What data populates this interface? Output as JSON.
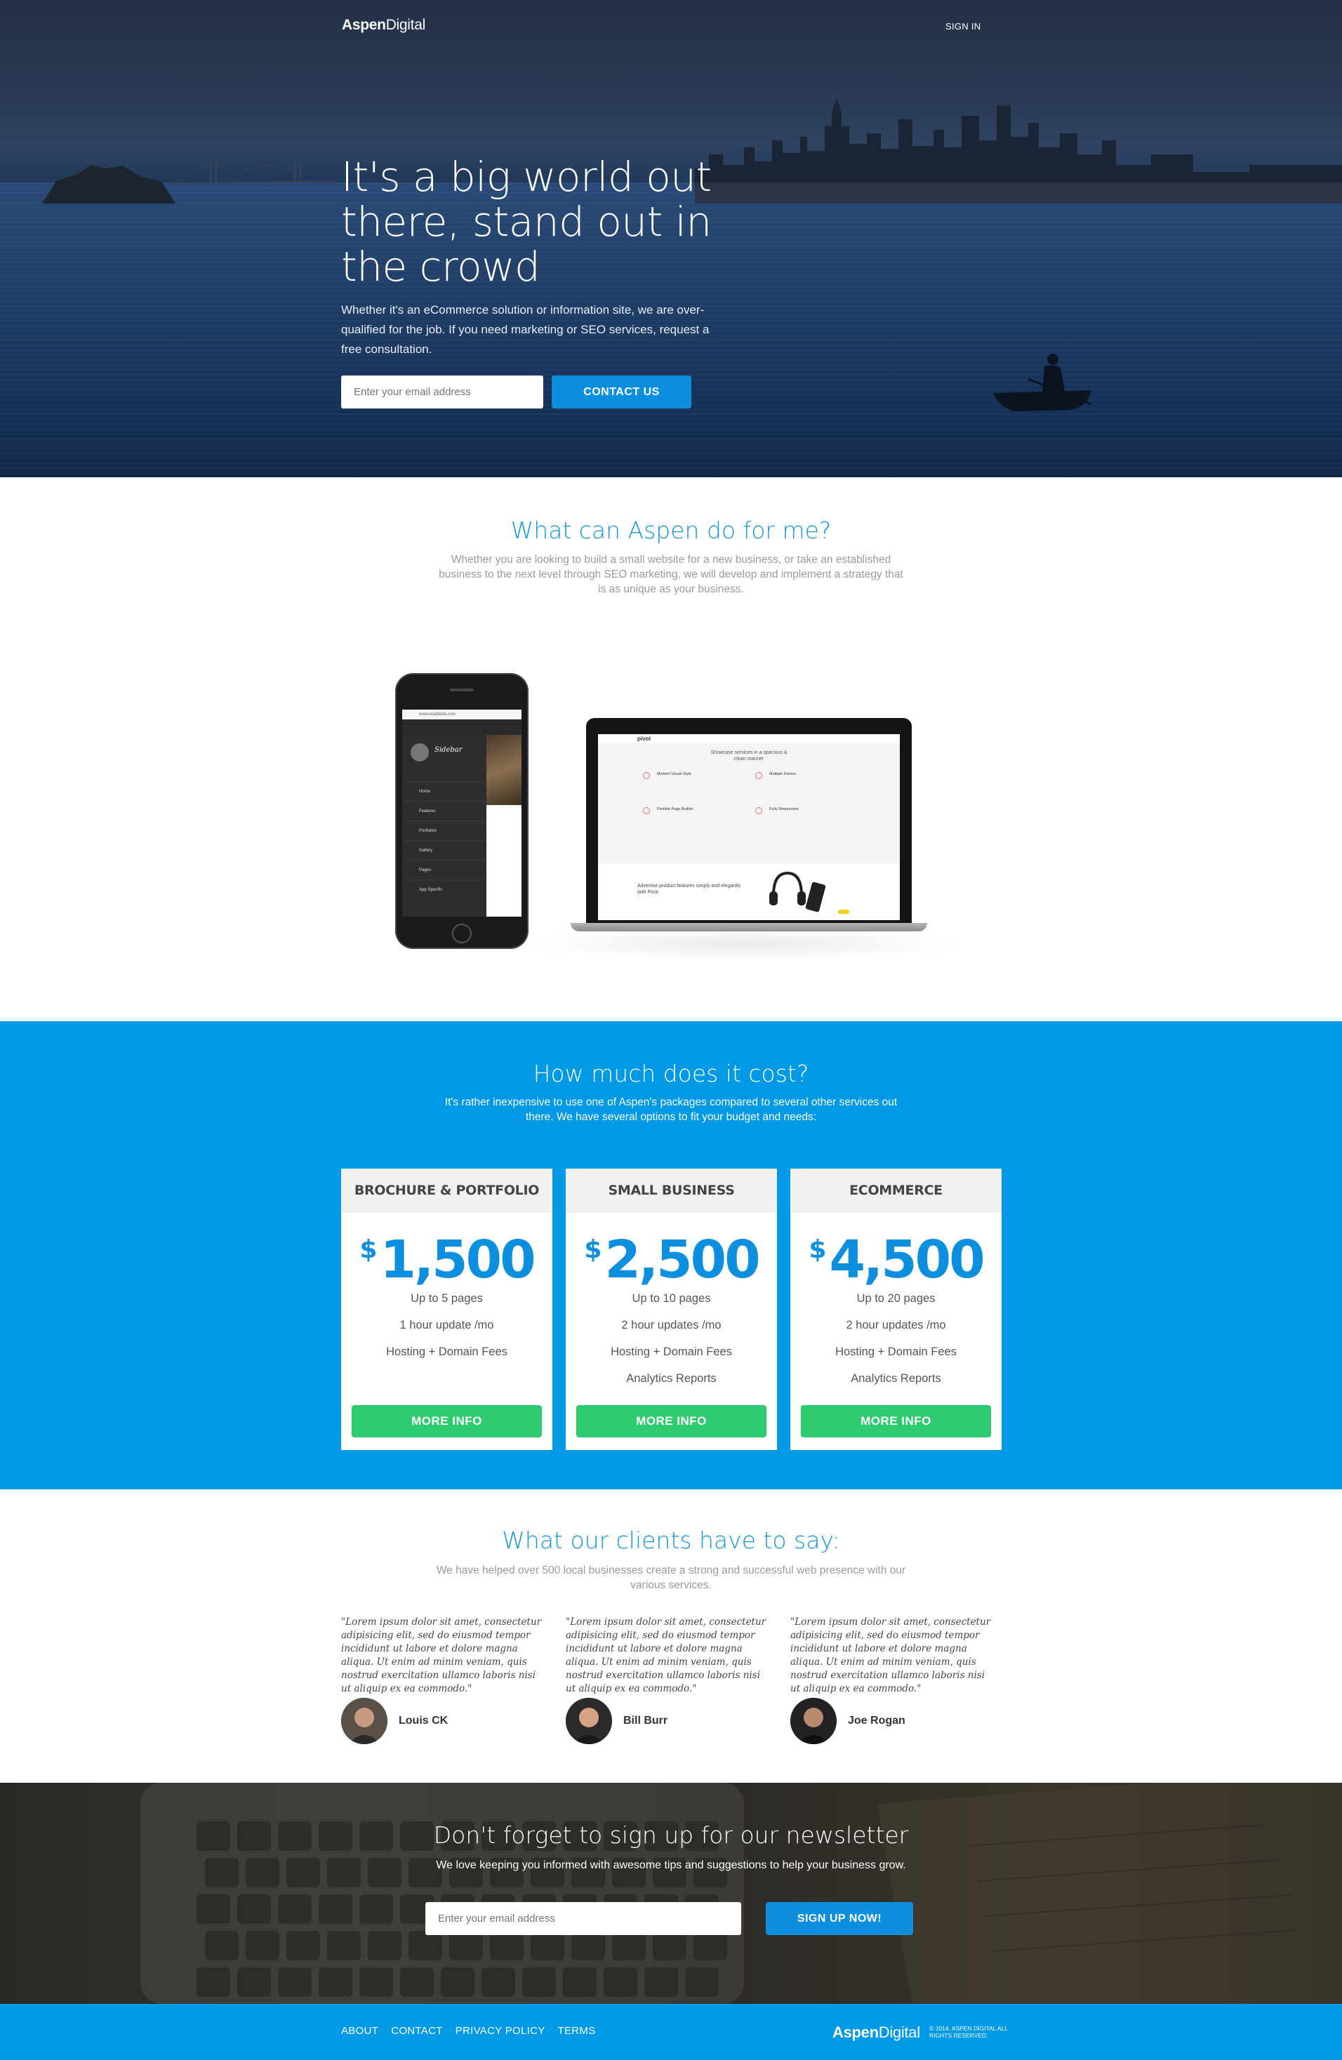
{
  "header": {
    "brand_bold": "Aspen",
    "brand_light": "Digital",
    "signin_label": "SIGN IN"
  },
  "hero": {
    "title": "It's a big world out there, stand out in the crowd",
    "lead": "Whether it's an eCommerce solution or information site, we are over-qualified for the job. If you need marketing or SEO services, request a free consultation.",
    "email_placeholder": "Enter your email address",
    "contact_label": "CONTACT US"
  },
  "services": {
    "title": "What can Aspen do for me?",
    "subtitle": "Whether you are looking to build a small website for a new business, or take an established business to the next level through SEO marketing, we will develop and implement a strategy that is as unique as your business."
  },
  "pricing": {
    "title": "How much does it cost?",
    "subtitle": "It's rather inexpensive to use one of Aspen's packages compared to several other services out there. We have several options to fit your budget and needs:",
    "plans": [
      {
        "name": "BROCHURE & PORTFOLIO",
        "currency": "$",
        "price": "1,500",
        "features": [
          "Up to 5 pages",
          "1 hour update /mo",
          "Hosting + Domain Fees"
        ],
        "button": "MORE INFO"
      },
      {
        "name": "SMALL BUSINESS",
        "currency": "$",
        "price": "2,500",
        "features": [
          "Up to 10 pages",
          "2 hour updates /mo",
          "Hosting + Domain Fees",
          "Analytics Reports"
        ],
        "button": "MORE INFO"
      },
      {
        "name": "ECOMMERCE",
        "currency": "$",
        "price": "4,500",
        "features": [
          "Up to 20 pages",
          "2 hour updates /mo",
          "Hosting + Domain Fees",
          "Analytics Reports"
        ],
        "button": "MORE INFO"
      }
    ]
  },
  "testimonials": {
    "title": "What our clients have to say:",
    "subtitle": "We have helped over 500 local businesses create a strong and successful web presence with our various services.",
    "items": [
      {
        "quote": "\"Lorem ipsum dolor sit amet, consectetur adipisicing elit, sed do eiusmod tempor incididunt ut labore et dolore magna aliqua. Ut enim ad minim veniam, quis nostrud exercitation ullamco laboris nisi ut aliquip ex ea commodo.\"",
        "name": "Louis CK"
      },
      {
        "quote": "\"Lorem ipsum dolor sit amet, consectetur adipisicing elit, sed do eiusmod tempor incididunt ut labore et dolore magna aliqua. Ut enim ad minim veniam, quis nostrud exercitation ullamco laboris nisi ut aliquip ex ea commodo.\"",
        "name": "Bill Burr"
      },
      {
        "quote": "\"Lorem ipsum dolor sit amet, consectetur adipisicing elit, sed do eiusmod tempor incididunt ut labore et dolore magna aliqua. Ut enim ad minim veniam, quis nostrud exercitation ullamco laboris nisi ut aliquip ex ea commodo.\"",
        "name": "Joe Rogan"
      }
    ]
  },
  "newsletter": {
    "title": "Don't forget to sign up for our newsletter",
    "subtitle": "We love keeping you informed with awesome tips and suggestions to help your business grow.",
    "email_placeholder": "Enter your email address",
    "button": "SIGN UP NOW!"
  },
  "footer": {
    "links": [
      "ABOUT",
      "CONTACT",
      "PRIVACY POLICY",
      "TERMS"
    ],
    "brand_bold": "Aspen",
    "brand_light": "Digital",
    "copyright": "© 2014. ASPEN DIGITAL ALL RIGHTS RESERVED."
  },
  "devices": {
    "laptop_brand": "pivot",
    "laptop_headline": "Showcase services in a spacious & clean manner",
    "laptop_footer_text": "Advertise product features simply and elegantly with Pivot",
    "phone_brand": "Sidebar",
    "phone_url": "www.enabledo.com",
    "phone_menu": [
      "Home",
      "Features",
      "Portfolios",
      "Gallery",
      "Pages",
      "App Specific"
    ],
    "laptop_features": [
      "Modern Visual Style",
      "Multiple Demos",
      "Flexible Page Builder",
      "Fully Responsive"
    ]
  },
  "colors": {
    "accent": "#0099e5",
    "button_blue": "#0d8fe0",
    "button_green": "#2ecc71",
    "title_blue": "#1496e1"
  }
}
